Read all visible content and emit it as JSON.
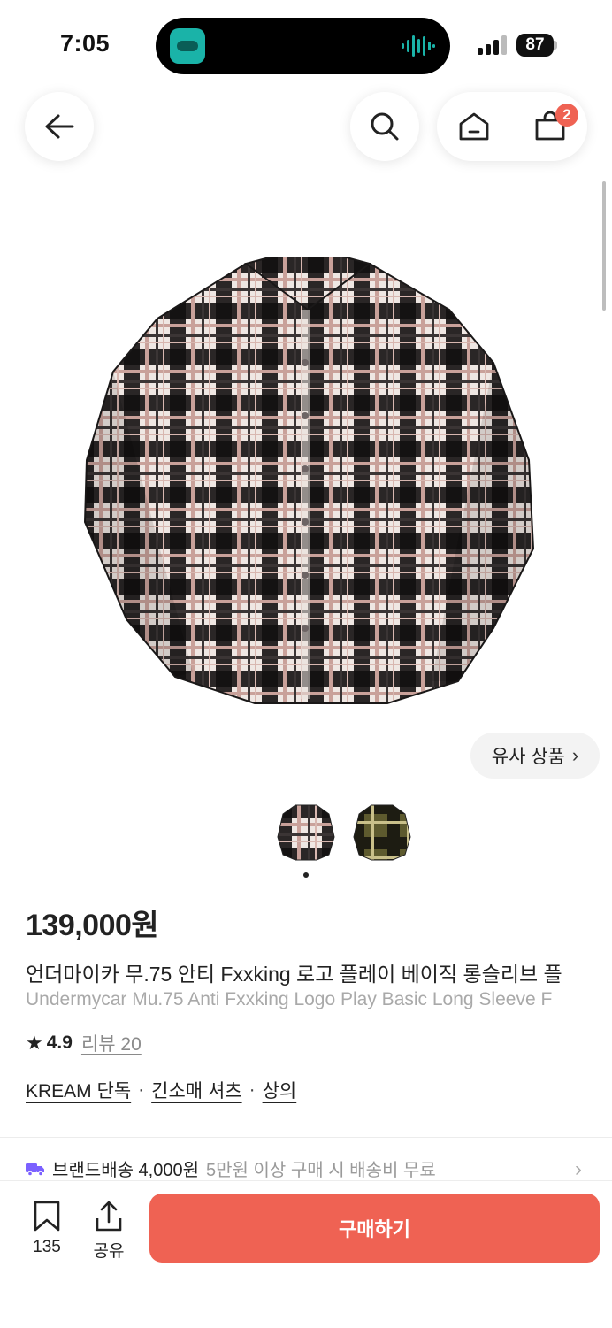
{
  "status_bar": {
    "time": "7:05",
    "battery": "87"
  },
  "nav": {
    "cart_count": "2"
  },
  "similar_products": {
    "label": "유사 상품"
  },
  "gallery": {
    "image_count": 2,
    "active_index": 1
  },
  "product": {
    "price": "139,000원",
    "title_ko": "언더마이카 무.75 안티 Fxxking 로고 플레이 베이직 롱슬리브 플",
    "title_en": "Undermycar Mu.75 Anti Fxxking Logo Play Basic Long Sleeve F",
    "rating": "4.9",
    "review_label": "리뷰 20",
    "tags": [
      "KREAM 단독",
      "긴소매 셔츠",
      "상의"
    ]
  },
  "shipping": {
    "label": "브랜드배송 4,000원",
    "note": "5만원 이상 구매 시 배송비 무료"
  },
  "bottom_bar": {
    "bookmark_count": "135",
    "share_label": "공유",
    "buy_label": "구매하기"
  },
  "colors": {
    "accent": "#ef6253",
    "truck": "#7b61ff",
    "muted_text": "#a9a9a9"
  },
  "icons": [
    "back-arrow-icon",
    "search-icon",
    "home-icon",
    "cart-icon",
    "chevron-right-icon",
    "star-icon",
    "truck-icon",
    "bookmark-icon",
    "share-icon"
  ]
}
